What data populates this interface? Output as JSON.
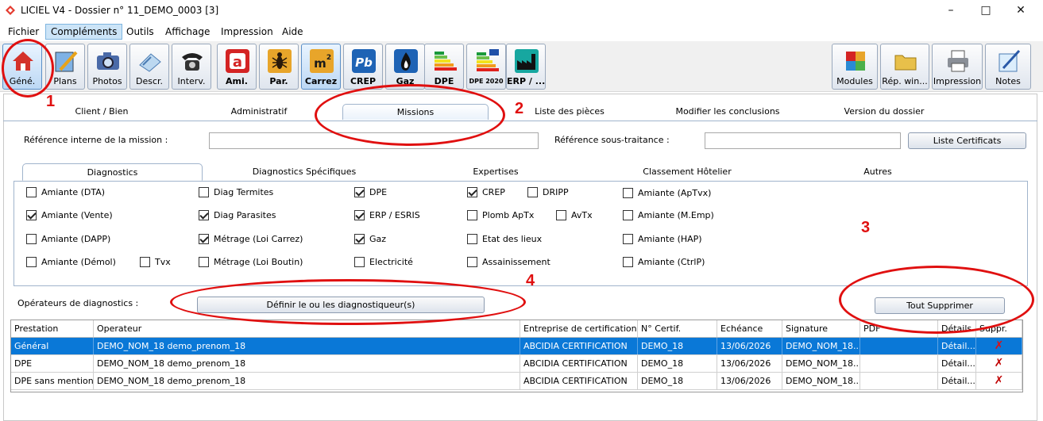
{
  "window": {
    "title": "LICIEL V4 - Dossier n° 11_DEMO_0003 [3]"
  },
  "menu": [
    "Fichier",
    "Compléments",
    "Outils",
    "Affichage",
    "Impression",
    "Aide"
  ],
  "toolbar": {
    "left": [
      {
        "label": "Géné.",
        "icon": "house-icon"
      },
      {
        "label": "Plans",
        "icon": "plans-icon"
      },
      {
        "label": "Photos",
        "icon": "camera-icon"
      },
      {
        "label": "Descr.",
        "icon": "description-icon"
      },
      {
        "label": "Interv.",
        "icon": "phone-icon"
      },
      {
        "label": "Ami.",
        "icon": "amiante-icon"
      },
      {
        "label": "Par.",
        "icon": "termite-icon"
      },
      {
        "label": "Carrez",
        "icon": "m2-icon"
      },
      {
        "label": "CREP",
        "icon": "pb-icon"
      },
      {
        "label": "Gaz",
        "icon": "flame-icon"
      },
      {
        "label": "DPE",
        "icon": "dpe-icon"
      },
      {
        "label": "DPE 2020",
        "icon": "dpe2020-icon"
      },
      {
        "label": "ERP / ...",
        "icon": "factory-icon"
      }
    ],
    "right": [
      {
        "label": "Modules",
        "icon": "puzzle-icon"
      },
      {
        "label": "Rép. win...",
        "icon": "folder-icon"
      },
      {
        "label": "Impression",
        "icon": "printer-icon"
      },
      {
        "label": "Notes",
        "icon": "notes-icon"
      }
    ]
  },
  "annotations": [
    "1",
    "2",
    "3",
    "4"
  ],
  "main_tabs": [
    "Client / Bien",
    "Administratif",
    "Missions",
    "Liste des pièces",
    "Modifier les conclusions",
    "Version du dossier"
  ],
  "mission": {
    "ref_label": "Référence interne de la mission :",
    "ref_value": "",
    "sous_traitance_label": "Référence sous-traitance :",
    "sous_traitance_value": "",
    "list_cert_button": "Liste Certificats"
  },
  "sub_tabs": [
    "Diagnostics",
    "Diagnostics Spécifiques",
    "Expertises",
    "Classement Hôtelier",
    "Autres"
  ],
  "checkboxes": [
    {
      "label": "Amiante (DTA)",
      "checked": false
    },
    {
      "label": "Amiante (Vente)",
      "checked": true
    },
    {
      "label": "Amiante (DAPP)",
      "checked": false
    },
    {
      "label": "Amiante (Démol)",
      "checked": false
    },
    {
      "label": "Tvx",
      "checked": false
    },
    {
      "label": "Diag Termites",
      "checked": false
    },
    {
      "label": "Diag Parasites",
      "checked": true
    },
    {
      "label": "Métrage (Loi Carrez)",
      "checked": true
    },
    {
      "label": "Métrage (Loi Boutin)",
      "checked": false
    },
    {
      "label": "DPE",
      "checked": true
    },
    {
      "label": "ERP / ESRIS",
      "checked": true
    },
    {
      "label": "Gaz",
      "checked": true
    },
    {
      "label": "Electricité",
      "checked": false
    },
    {
      "label": "CREP",
      "checked": true
    },
    {
      "label": "DRIPP",
      "checked": false
    },
    {
      "label": "Plomb ApTx",
      "checked": false
    },
    {
      "label": "AvTx",
      "checked": false
    },
    {
      "label": "Etat des lieux",
      "checked": false
    },
    {
      "label": "Assainissement",
      "checked": false
    },
    {
      "label": "Amiante (ApTvx)",
      "checked": false
    },
    {
      "label": "Amiante (M.Emp)",
      "checked": false
    },
    {
      "label": "Amiante (HAP)",
      "checked": false
    },
    {
      "label": "Amiante (CtrlP)",
      "checked": false
    }
  ],
  "operators": {
    "label": "Opérateurs de diagnostics :",
    "define_button": "Définir le ou les diagnostiqueur(s)",
    "delete_all_button": "Tout Supprimer"
  },
  "table": {
    "columns": [
      "Prestation",
      "Operateur",
      "Entreprise de certification",
      "N° Certif.",
      "Echéance",
      "Signature",
      "PDF",
      "Détails",
      "Suppr."
    ],
    "rows": [
      [
        "Général",
        "DEMO_NOM_18 demo_prenom_18",
        "ABCIDIA CERTIFICATION",
        "DEMO_18",
        "13/06/2026",
        "DEMO_NOM_18...",
        "",
        "Détail...",
        "✗"
      ],
      [
        "DPE",
        "DEMO_NOM_18 demo_prenom_18",
        "ABCIDIA CERTIFICATION",
        "DEMO_18",
        "13/06/2026",
        "DEMO_NOM_18...",
        "",
        "Détail...",
        "✗"
      ],
      [
        "DPE sans mention",
        "DEMO_NOM_18 demo_prenom_18",
        "ABCIDIA CERTIFICATION",
        "DEMO_18",
        "13/06/2026",
        "DEMO_NOM_18...",
        "",
        "Détail...",
        "✗"
      ]
    ],
    "selected_row": 0
  },
  "colors": {
    "annotation": "#e01010",
    "selection": "#0a78d7",
    "delete": "#c00000"
  }
}
